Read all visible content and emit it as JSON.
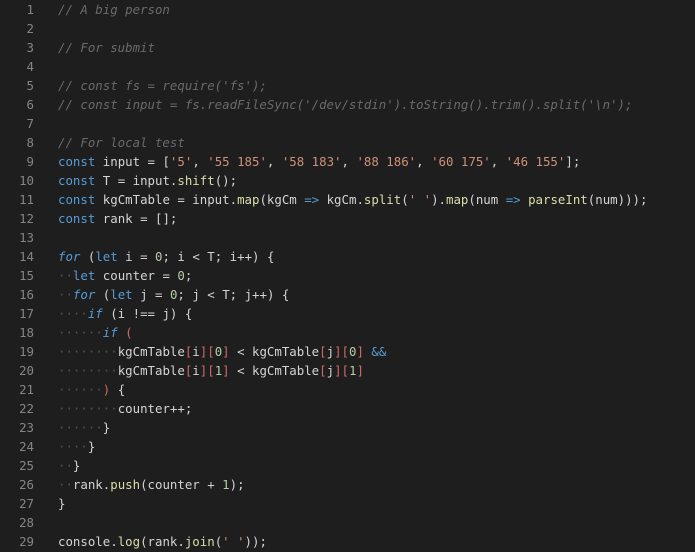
{
  "editor": {
    "lines": [
      {
        "number": "1",
        "tokens": [
          {
            "t": "// A big person",
            "c": "comment"
          }
        ]
      },
      {
        "number": "2",
        "tokens": []
      },
      {
        "number": "3",
        "tokens": [
          {
            "t": "// For submit",
            "c": "comment"
          }
        ]
      },
      {
        "number": "4",
        "tokens": []
      },
      {
        "number": "5",
        "tokens": [
          {
            "t": "// const fs = require('fs');",
            "c": "comment"
          }
        ]
      },
      {
        "number": "6",
        "tokens": [
          {
            "t": "// const input = fs.readFileSync('/dev/stdin').toString().trim().split('\\n');",
            "c": "comment"
          }
        ]
      },
      {
        "number": "7",
        "tokens": []
      },
      {
        "number": "8",
        "tokens": [
          {
            "t": "// For local test",
            "c": "comment"
          }
        ]
      },
      {
        "number": "9",
        "tokens": [
          {
            "t": "const",
            "c": "keyword"
          },
          {
            "t": " input ",
            "c": "ident"
          },
          {
            "t": "=",
            "c": "operator"
          },
          {
            "t": " [",
            "c": "punct"
          },
          {
            "t": "'5'",
            "c": "string"
          },
          {
            "t": ", ",
            "c": "punct"
          },
          {
            "t": "'55 185'",
            "c": "string"
          },
          {
            "t": ", ",
            "c": "punct"
          },
          {
            "t": "'58 183'",
            "c": "string"
          },
          {
            "t": ", ",
            "c": "punct"
          },
          {
            "t": "'88 186'",
            "c": "string"
          },
          {
            "t": ", ",
            "c": "punct"
          },
          {
            "t": "'60 175'",
            "c": "string"
          },
          {
            "t": ", ",
            "c": "punct"
          },
          {
            "t": "'46 155'",
            "c": "string"
          },
          {
            "t": "];",
            "c": "punct"
          }
        ]
      },
      {
        "number": "10",
        "tokens": [
          {
            "t": "const",
            "c": "keyword"
          },
          {
            "t": " T ",
            "c": "ident"
          },
          {
            "t": "=",
            "c": "operator"
          },
          {
            "t": " input.",
            "c": "ident"
          },
          {
            "t": "shift",
            "c": "method"
          },
          {
            "t": "();",
            "c": "punct"
          }
        ]
      },
      {
        "number": "11",
        "tokens": [
          {
            "t": "const",
            "c": "keyword"
          },
          {
            "t": " kgCmTable ",
            "c": "ident"
          },
          {
            "t": "=",
            "c": "operator"
          },
          {
            "t": " input.",
            "c": "ident"
          },
          {
            "t": "map",
            "c": "method"
          },
          {
            "t": "(kgCm ",
            "c": "punct"
          },
          {
            "t": "=>",
            "c": "keyword"
          },
          {
            "t": " kgCm.",
            "c": "ident"
          },
          {
            "t": "split",
            "c": "method"
          },
          {
            "t": "(",
            "c": "punct"
          },
          {
            "t": "' '",
            "c": "string"
          },
          {
            "t": ").",
            "c": "punct"
          },
          {
            "t": "map",
            "c": "method"
          },
          {
            "t": "(num ",
            "c": "punct"
          },
          {
            "t": "=>",
            "c": "keyword"
          },
          {
            "t": " ",
            "c": "punct"
          },
          {
            "t": "parseInt",
            "c": "method"
          },
          {
            "t": "(num)));",
            "c": "punct"
          }
        ]
      },
      {
        "number": "12",
        "tokens": [
          {
            "t": "const",
            "c": "keyword"
          },
          {
            "t": " rank ",
            "c": "ident"
          },
          {
            "t": "=",
            "c": "operator"
          },
          {
            "t": " [];",
            "c": "punct"
          }
        ]
      },
      {
        "number": "13",
        "tokens": []
      },
      {
        "number": "14",
        "tokens": [
          {
            "t": "for",
            "c": "control"
          },
          {
            "t": " (",
            "c": "punct"
          },
          {
            "t": "let",
            "c": "keyword"
          },
          {
            "t": " i ",
            "c": "ident"
          },
          {
            "t": "=",
            "c": "operator"
          },
          {
            "t": " ",
            "c": "punct"
          },
          {
            "t": "0",
            "c": "number"
          },
          {
            "t": "; i ",
            "c": "punct"
          },
          {
            "t": "<",
            "c": "operator"
          },
          {
            "t": " T; i",
            "c": "punct"
          },
          {
            "t": "++",
            "c": "operator"
          },
          {
            "t": ") {",
            "c": "punct"
          }
        ]
      },
      {
        "number": "15",
        "tokens": [
          {
            "t": "··",
            "c": "whitespace"
          },
          {
            "t": "let",
            "c": "keyword"
          },
          {
            "t": " counter ",
            "c": "ident"
          },
          {
            "t": "=",
            "c": "operator"
          },
          {
            "t": " ",
            "c": "punct"
          },
          {
            "t": "0",
            "c": "number"
          },
          {
            "t": ";",
            "c": "punct"
          }
        ]
      },
      {
        "number": "16",
        "tokens": [
          {
            "t": "··",
            "c": "whitespace"
          },
          {
            "t": "for",
            "c": "control"
          },
          {
            "t": " (",
            "c": "punct"
          },
          {
            "t": "let",
            "c": "keyword"
          },
          {
            "t": " j ",
            "c": "ident"
          },
          {
            "t": "=",
            "c": "operator"
          },
          {
            "t": " ",
            "c": "punct"
          },
          {
            "t": "0",
            "c": "number"
          },
          {
            "t": "; j ",
            "c": "punct"
          },
          {
            "t": "<",
            "c": "operator"
          },
          {
            "t": " T; j",
            "c": "punct"
          },
          {
            "t": "++",
            "c": "operator"
          },
          {
            "t": ") {",
            "c": "punct"
          }
        ]
      },
      {
        "number": "17",
        "tokens": [
          {
            "t": "····",
            "c": "whitespace"
          },
          {
            "t": "if",
            "c": "control"
          },
          {
            "t": " (i ",
            "c": "punct"
          },
          {
            "t": "!==",
            "c": "operator"
          },
          {
            "t": " j) {",
            "c": "punct"
          }
        ]
      },
      {
        "number": "18",
        "tokens": [
          {
            "t": "······",
            "c": "whitespace"
          },
          {
            "t": "if",
            "c": "control"
          },
          {
            "t": " ",
            "c": "punct"
          },
          {
            "t": "(",
            "c": "bracket"
          }
        ]
      },
      {
        "number": "19",
        "tokens": [
          {
            "t": "········",
            "c": "whitespace"
          },
          {
            "t": "kgCmTable",
            "c": "ident"
          },
          {
            "t": "[",
            "c": "bracket"
          },
          {
            "t": "i",
            "c": "ident"
          },
          {
            "t": "][",
            "c": "bracket"
          },
          {
            "t": "0",
            "c": "number"
          },
          {
            "t": "]",
            "c": "bracket"
          },
          {
            "t": " < kgCmTable",
            "c": "ident"
          },
          {
            "t": "[",
            "c": "bracket"
          },
          {
            "t": "j",
            "c": "ident"
          },
          {
            "t": "][",
            "c": "bracket"
          },
          {
            "t": "0",
            "c": "number"
          },
          {
            "t": "]",
            "c": "bracket"
          },
          {
            "t": " &&",
            "c": "keyword"
          }
        ]
      },
      {
        "number": "20",
        "tokens": [
          {
            "t": "········",
            "c": "whitespace"
          },
          {
            "t": "kgCmTable",
            "c": "ident"
          },
          {
            "t": "[",
            "c": "bracket"
          },
          {
            "t": "i",
            "c": "ident"
          },
          {
            "t": "][",
            "c": "bracket"
          },
          {
            "t": "1",
            "c": "number"
          },
          {
            "t": "]",
            "c": "bracket"
          },
          {
            "t": " < kgCmTable",
            "c": "ident"
          },
          {
            "t": "[",
            "c": "bracket"
          },
          {
            "t": "j",
            "c": "ident"
          },
          {
            "t": "][",
            "c": "bracket"
          },
          {
            "t": "1",
            "c": "number"
          },
          {
            "t": "]",
            "c": "bracket"
          }
        ]
      },
      {
        "number": "21",
        "tokens": [
          {
            "t": "······",
            "c": "whitespace"
          },
          {
            "t": ")",
            "c": "bracket"
          },
          {
            "t": " {",
            "c": "punct"
          }
        ]
      },
      {
        "number": "22",
        "tokens": [
          {
            "t": "········",
            "c": "whitespace"
          },
          {
            "t": "counter",
            "c": "ident"
          },
          {
            "t": "++",
            "c": "operator"
          },
          {
            "t": ";",
            "c": "punct"
          }
        ]
      },
      {
        "number": "23",
        "tokens": [
          {
            "t": "······",
            "c": "whitespace"
          },
          {
            "t": "}",
            "c": "punct"
          }
        ]
      },
      {
        "number": "24",
        "tokens": [
          {
            "t": "····",
            "c": "whitespace"
          },
          {
            "t": "}",
            "c": "punct"
          }
        ]
      },
      {
        "number": "25",
        "tokens": [
          {
            "t": "··",
            "c": "whitespace"
          },
          {
            "t": "}",
            "c": "punct"
          }
        ]
      },
      {
        "number": "26",
        "tokens": [
          {
            "t": "··",
            "c": "whitespace"
          },
          {
            "t": "rank.",
            "c": "ident"
          },
          {
            "t": "push",
            "c": "method"
          },
          {
            "t": "(counter ",
            "c": "punct"
          },
          {
            "t": "+",
            "c": "operator"
          },
          {
            "t": " ",
            "c": "punct"
          },
          {
            "t": "1",
            "c": "number"
          },
          {
            "t": ");",
            "c": "punct"
          }
        ]
      },
      {
        "number": "27",
        "tokens": [
          {
            "t": "}",
            "c": "punct"
          }
        ]
      },
      {
        "number": "28",
        "tokens": []
      },
      {
        "number": "29",
        "tokens": [
          {
            "t": "console",
            "c": "ident"
          },
          {
            "t": ".",
            "c": "punct"
          },
          {
            "t": "log",
            "c": "method"
          },
          {
            "t": "(rank.",
            "c": "punct"
          },
          {
            "t": "join",
            "c": "method"
          },
          {
            "t": "(",
            "c": "punct"
          },
          {
            "t": "' '",
            "c": "string"
          },
          {
            "t": "));",
            "c": "punct"
          }
        ]
      }
    ]
  }
}
